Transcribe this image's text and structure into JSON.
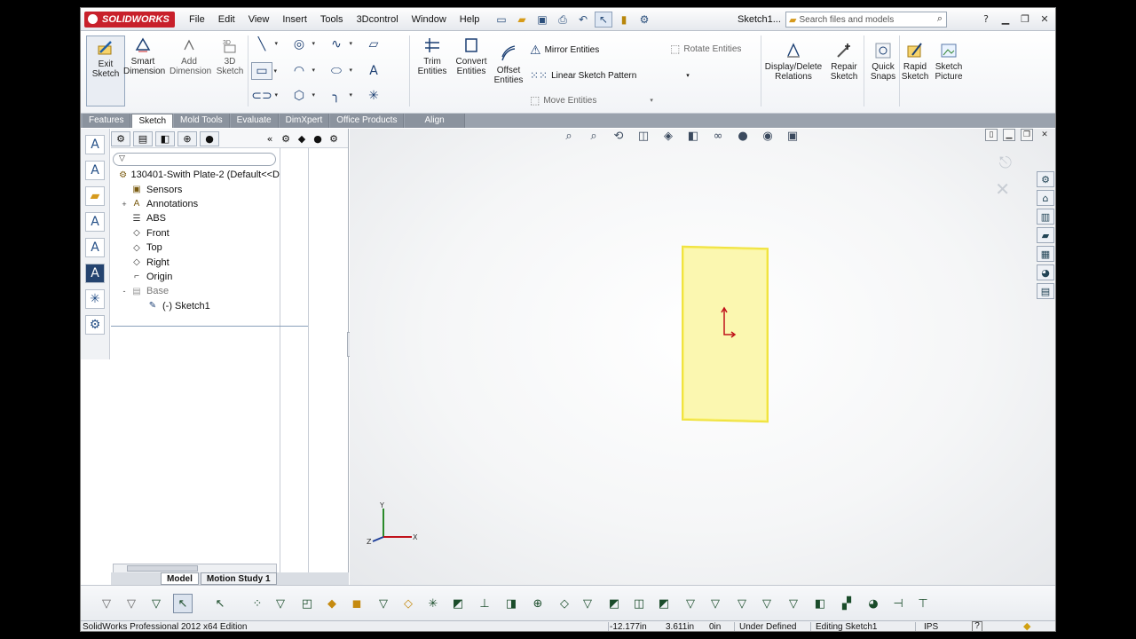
{
  "app": {
    "logo": "SOLIDWORKS",
    "doc_name": "Sketch1..."
  },
  "menu": [
    "File",
    "Edit",
    "View",
    "Insert",
    "Tools",
    "3Dcontrol",
    "Window",
    "Help"
  ],
  "search": {
    "placeholder": "Search files and models"
  },
  "command_manager": {
    "exit_sketch": "Exit Sketch",
    "smart_dimension": "Smart Dimension",
    "add_dimension": "Add Dimension",
    "sketch_3d": "3D Sketch",
    "trim": "Trim Entities",
    "convert": "Convert Entities",
    "offset": "Offset Entities",
    "mirror": "Mirror Entities",
    "linear_pattern": "Linear Sketch Pattern",
    "move": "Move Entities",
    "rotate": "Rotate Entities",
    "display_delete": "Display/Delete Relations",
    "repair": "Repair Sketch",
    "quick_snaps": "Quick Snaps",
    "rapid_sketch": "Rapid Sketch",
    "sketch_picture": "Sketch Picture"
  },
  "tabs": [
    "Features",
    "Sketch",
    "Mold Tools",
    "Evaluate",
    "DimXpert",
    "Office Products",
    "Align"
  ],
  "active_tab": "Sketch",
  "feature_tree": {
    "root": "130401-Swith Plate-2  (Default<<D",
    "items": [
      {
        "label": "Sensors",
        "icon": "sensors-icon",
        "expand": ""
      },
      {
        "label": "Annotations",
        "icon": "annotations-icon",
        "expand": "+"
      },
      {
        "label": "ABS",
        "icon": "material-icon",
        "expand": ""
      },
      {
        "label": "Front",
        "icon": "plane-icon",
        "expand": ""
      },
      {
        "label": "Top",
        "icon": "plane-icon",
        "expand": ""
      },
      {
        "label": "Right",
        "icon": "plane-icon",
        "expand": ""
      },
      {
        "label": "Origin",
        "icon": "origin-icon",
        "expand": ""
      },
      {
        "label": "Base",
        "icon": "base-feature-icon",
        "expand": "-"
      },
      {
        "label": "(-) Sketch1",
        "icon": "sketch-icon",
        "expand": ""
      }
    ]
  },
  "bottom_tabs": [
    "Model",
    "Motion Study 1"
  ],
  "triad": {
    "x": "X",
    "y": "Y",
    "z": "Z"
  },
  "status": {
    "edition": "SolidWorks Professional 2012 x64 Edition",
    "x": "-12.177in",
    "y": "3.611in",
    "z": "0in",
    "state": "Under Defined",
    "editing": "Editing Sketch1",
    "units": "IPS",
    "help": "?"
  },
  "colors": {
    "accent": "#c8202b",
    "plate_fill": "#fbf7b0",
    "plate_edge": "#f0e341"
  }
}
